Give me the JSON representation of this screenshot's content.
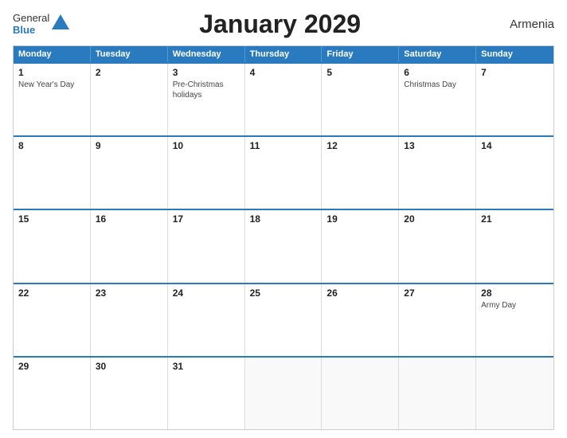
{
  "header": {
    "title": "January 2029",
    "country": "Armenia",
    "logo_general": "General",
    "logo_blue": "Blue"
  },
  "days_header": [
    "Monday",
    "Tuesday",
    "Wednesday",
    "Thursday",
    "Friday",
    "Saturday",
    "Sunday"
  ],
  "weeks": [
    [
      {
        "day": "1",
        "holiday": "New Year's Day"
      },
      {
        "day": "2",
        "holiday": ""
      },
      {
        "day": "3",
        "holiday": "Pre-Christmas holidays"
      },
      {
        "day": "4",
        "holiday": ""
      },
      {
        "day": "5",
        "holiday": ""
      },
      {
        "day": "6",
        "holiday": "Christmas Day"
      },
      {
        "day": "7",
        "holiday": ""
      }
    ],
    [
      {
        "day": "8",
        "holiday": ""
      },
      {
        "day": "9",
        "holiday": ""
      },
      {
        "day": "10",
        "holiday": ""
      },
      {
        "day": "11",
        "holiday": ""
      },
      {
        "day": "12",
        "holiday": ""
      },
      {
        "day": "13",
        "holiday": ""
      },
      {
        "day": "14",
        "holiday": ""
      }
    ],
    [
      {
        "day": "15",
        "holiday": ""
      },
      {
        "day": "16",
        "holiday": ""
      },
      {
        "day": "17",
        "holiday": ""
      },
      {
        "day": "18",
        "holiday": ""
      },
      {
        "day": "19",
        "holiday": ""
      },
      {
        "day": "20",
        "holiday": ""
      },
      {
        "day": "21",
        "holiday": ""
      }
    ],
    [
      {
        "day": "22",
        "holiday": ""
      },
      {
        "day": "23",
        "holiday": ""
      },
      {
        "day": "24",
        "holiday": ""
      },
      {
        "day": "25",
        "holiday": ""
      },
      {
        "day": "26",
        "holiday": ""
      },
      {
        "day": "27",
        "holiday": ""
      },
      {
        "day": "28",
        "holiday": "Army Day"
      }
    ],
    [
      {
        "day": "29",
        "holiday": ""
      },
      {
        "day": "30",
        "holiday": ""
      },
      {
        "day": "31",
        "holiday": ""
      },
      {
        "day": "",
        "holiday": ""
      },
      {
        "day": "",
        "holiday": ""
      },
      {
        "day": "",
        "holiday": ""
      },
      {
        "day": "",
        "holiday": ""
      }
    ]
  ]
}
